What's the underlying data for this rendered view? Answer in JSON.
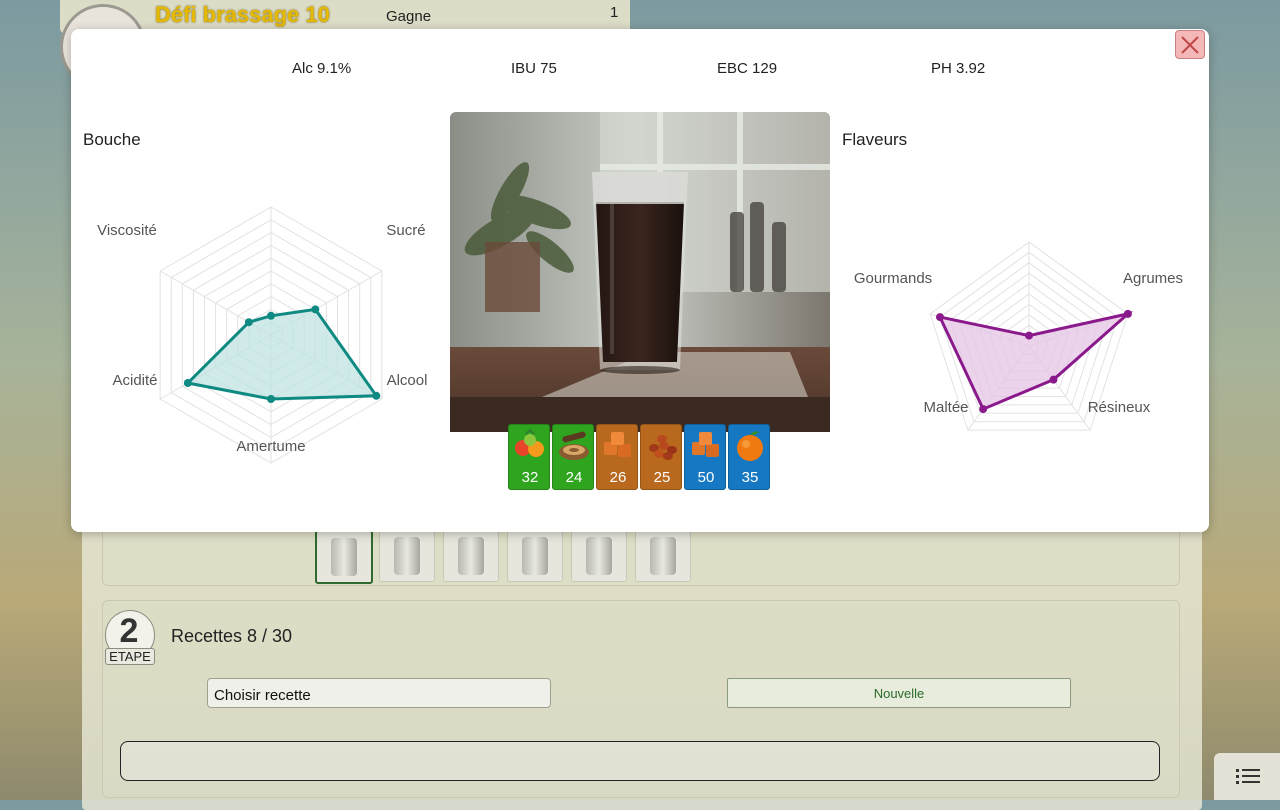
{
  "header": {
    "title": "Défi brassage 10",
    "status": "Gagne",
    "count": "1"
  },
  "stats": [
    {
      "id": "alc",
      "text": "Alc 9.1%"
    },
    {
      "id": "ibu",
      "text": "IBU 75"
    },
    {
      "id": "ebc",
      "text": "EBC 129"
    },
    {
      "id": "ph",
      "text": "PH 3.92"
    }
  ],
  "bouche": {
    "label": "Bouche",
    "axes": [
      "Sucré",
      "Alcool",
      "Amertume",
      "Acidité",
      "Viscosité"
    ],
    "values": [
      0.4,
      0.95,
      0.5,
      0.75,
      0.2
    ],
    "color": "#0f8a82",
    "fill": "#bfe3e1"
  },
  "flaveurs": {
    "label": "Flaveurs",
    "axes": [
      "Agrumes",
      "Résineux",
      "Maltée",
      "Gourmands"
    ],
    "values": [
      1.0,
      0.4,
      0.75,
      0.9,
      0.1
    ],
    "color": "#8a1a8c",
    "fill": "#e6c4e6"
  },
  "ingredients": [
    {
      "icon": "fruit-basket-icon",
      "value": "32",
      "bg": "#2fa51f"
    },
    {
      "icon": "wood-log-icon",
      "value": "24",
      "bg": "#2fa51f"
    },
    {
      "icon": "caramel-cubes-icon",
      "value": "26",
      "bg": "#b8691d"
    },
    {
      "icon": "roasted-beans-icon",
      "value": "25",
      "bg": "#b8691d"
    },
    {
      "icon": "caramel-cubes-icon",
      "value": "50",
      "bg": "#1678c2"
    },
    {
      "icon": "orange-icon",
      "value": "35",
      "bg": "#1678c2"
    }
  ],
  "step": {
    "number": "2",
    "label": "ETAPE",
    "recettes": "Recettes 8 / 30",
    "choose_placeholder": "Choisir recette",
    "new_label": "Nouvelle"
  }
}
